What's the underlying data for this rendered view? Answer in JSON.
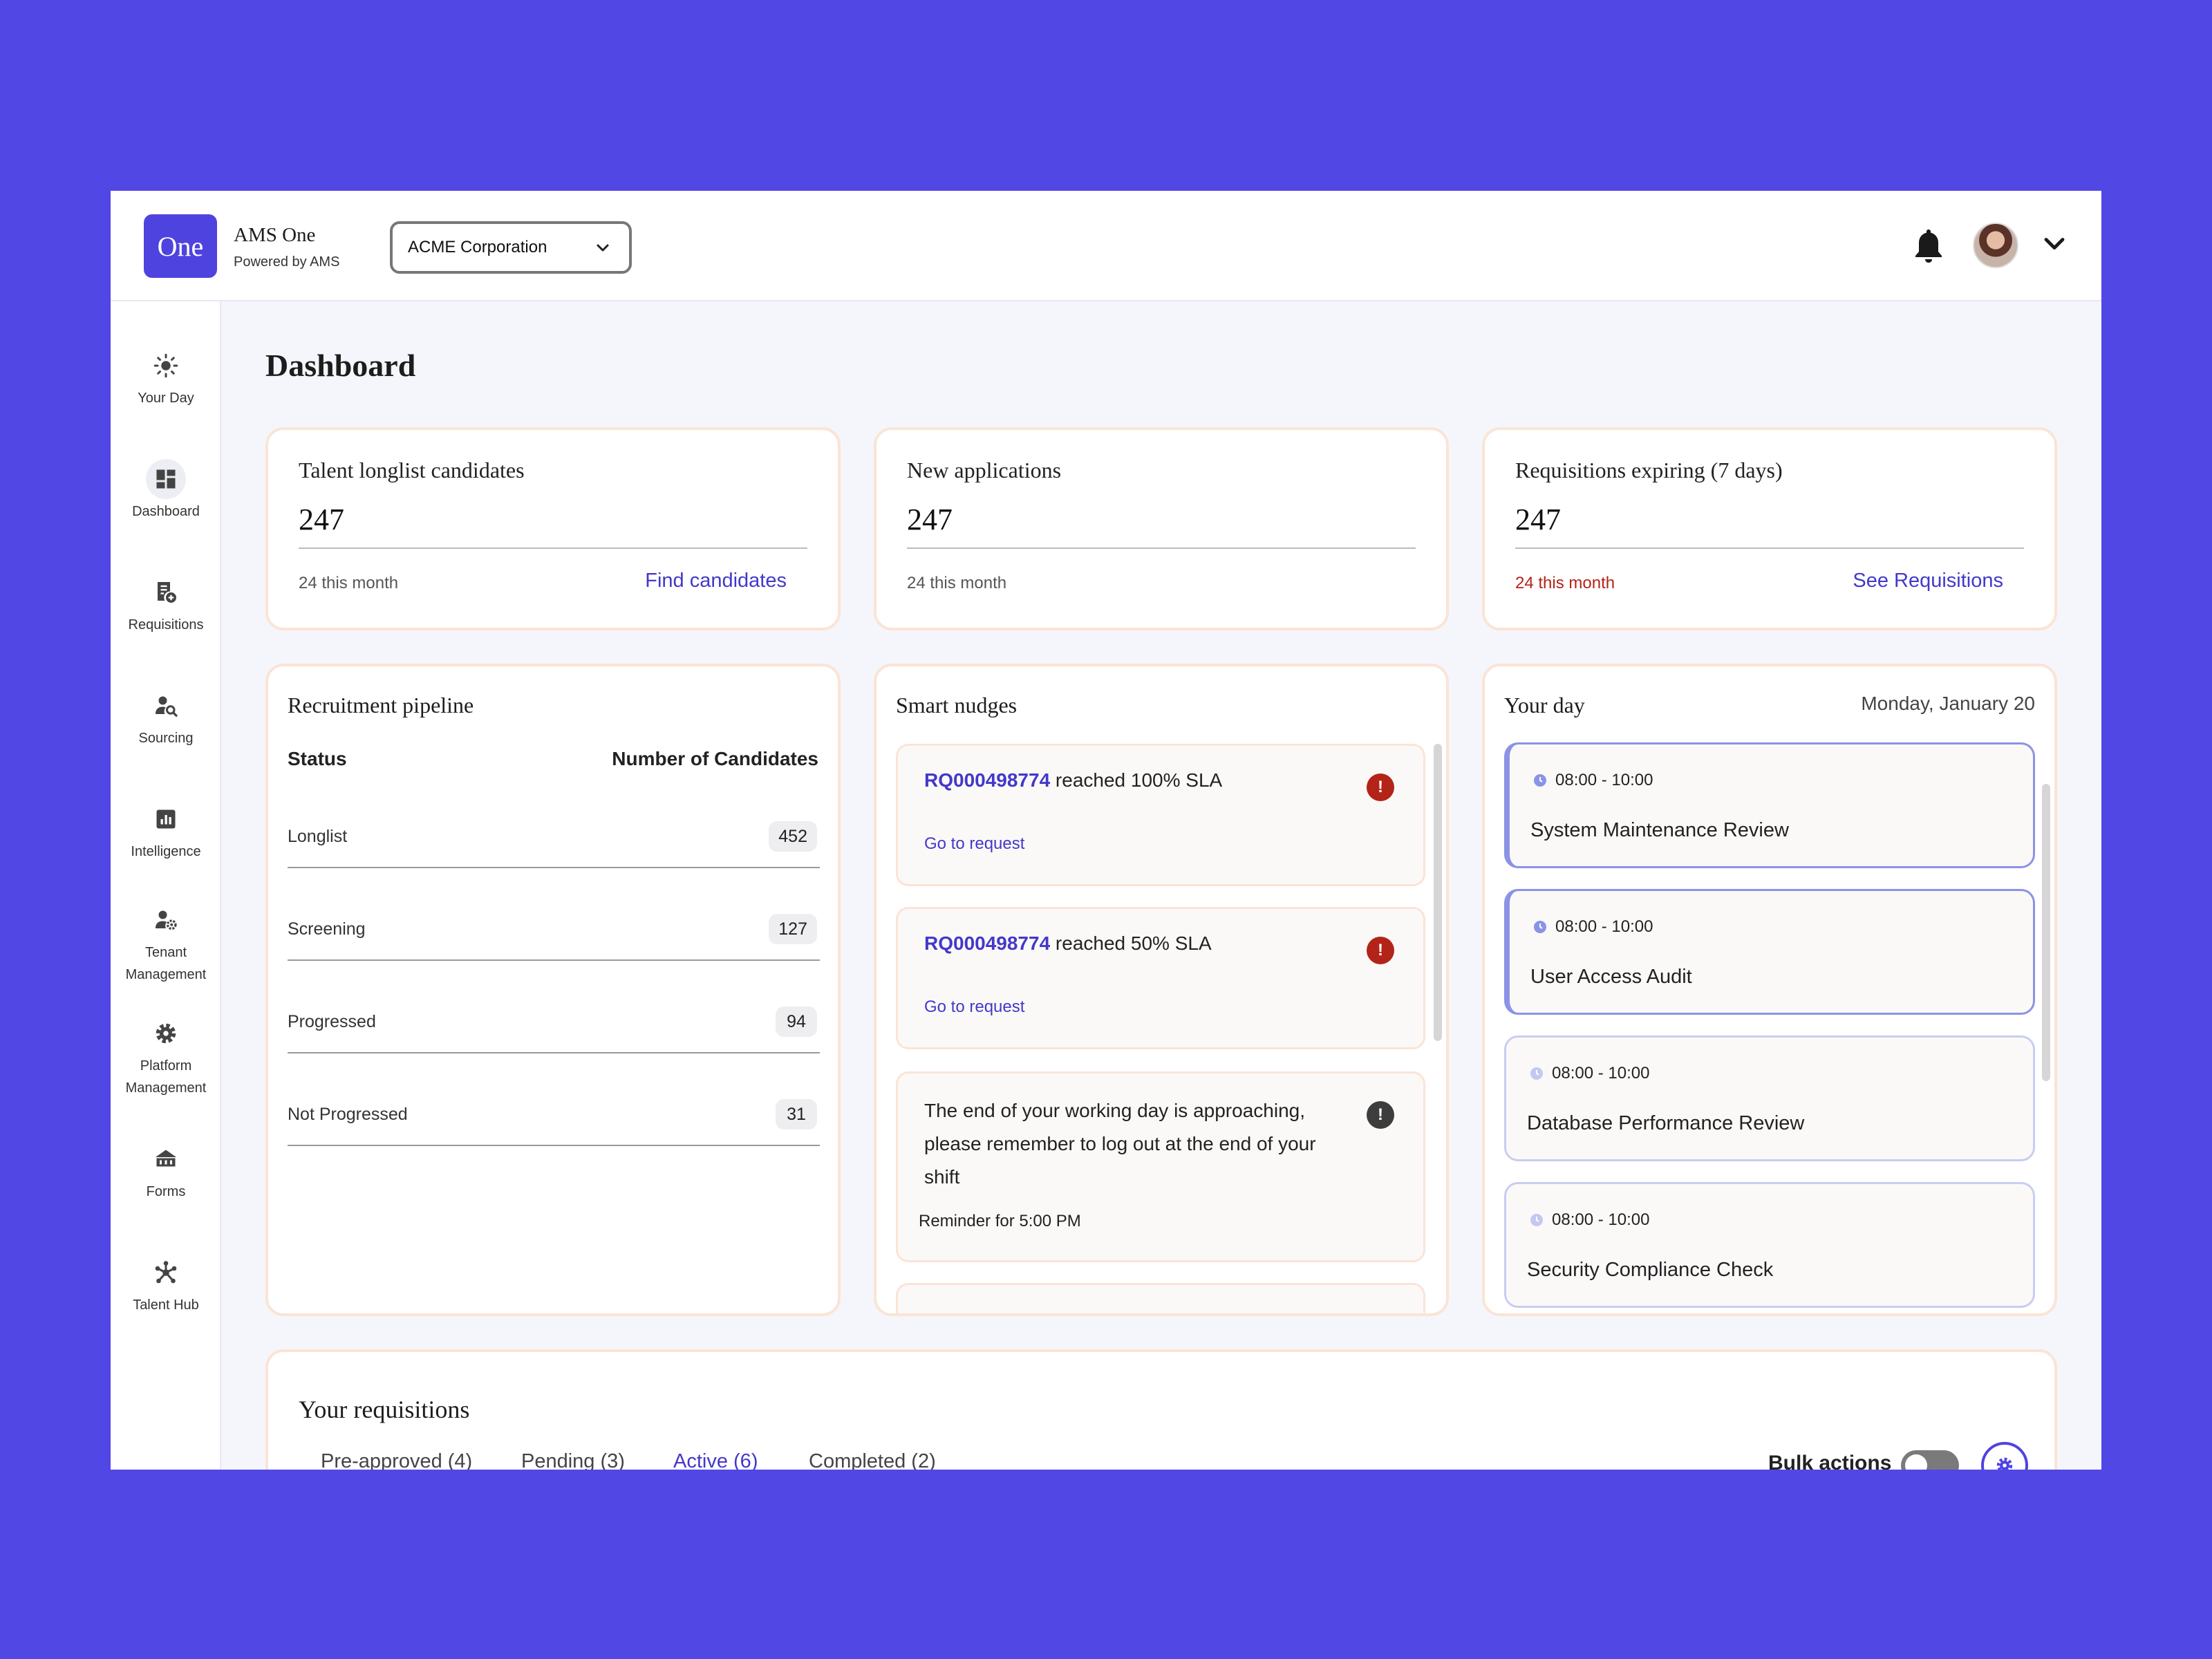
{
  "header": {
    "logo_text": "One",
    "app_name": "AMS One",
    "app_sub": "Powered by AMS",
    "org_selected": "ACME Corporation"
  },
  "sidebar": {
    "items": [
      {
        "label": "Your Day",
        "icon": "sun-icon"
      },
      {
        "label": "Dashboard",
        "icon": "dashboard-icon"
      },
      {
        "label": "Requisitions",
        "icon": "requisition-icon"
      },
      {
        "label": "Sourcing",
        "icon": "person-search-icon"
      },
      {
        "label": "Intelligence",
        "icon": "chart-icon"
      },
      {
        "label": "Tenant Management",
        "icon": "person-gear-icon"
      },
      {
        "label": "Platform Management",
        "icon": "gear-icon"
      },
      {
        "label": "Forms",
        "icon": "building-icon"
      },
      {
        "label": "Talent Hub",
        "icon": "network-icon"
      }
    ]
  },
  "page_title": "Dashboard",
  "stats": [
    {
      "title": "Talent longlist candidates",
      "value": "247",
      "sub": "24 this month",
      "link": "Find candidates"
    },
    {
      "title": "New applications",
      "value": "247",
      "sub": "24 this month",
      "link": ""
    },
    {
      "title": "Requisitions expiring (7 days)",
      "value": "247",
      "sub": "24 this month",
      "link": "See Requisitions"
    }
  ],
  "pipeline": {
    "title": "Recruitment pipeline",
    "col_status": "Status",
    "col_count": "Number of Candidates",
    "rows": [
      {
        "label": "Longlist",
        "count": "452"
      },
      {
        "label": "Screening",
        "count": "127"
      },
      {
        "label": "Progressed",
        "count": "94"
      },
      {
        "label": "Not Progressed",
        "count": "31"
      }
    ]
  },
  "nudges": {
    "title": "Smart nudges",
    "items": [
      {
        "req": "RQ000498774",
        "text": " reached 100% SLA",
        "link": "Go to request"
      },
      {
        "req": "RQ000498774",
        "text": " reached 50% SLA",
        "link": "Go to request"
      }
    ],
    "reminder": {
      "text": "The end of your working day is approaching, please remember to log out at the end of your shift",
      "sub": "Reminder for 5:00 PM"
    }
  },
  "your_day": {
    "title": "Your day",
    "date": "Monday, January 20",
    "events": [
      {
        "time": "08:00 - 10:00",
        "title": "System Maintenance Review"
      },
      {
        "time": "08:00 - 10:00",
        "title": "User Access Audit"
      },
      {
        "time": "08:00 - 10:00",
        "title": "Database Performance Review"
      },
      {
        "time": "08:00 - 10:00",
        "title": "Security Compliance Check"
      }
    ]
  },
  "requisitions": {
    "title": "Your requisitions",
    "tabs": [
      "Pre-approved (4)",
      "Pending (3)",
      "Active (6)",
      "Completed (2)"
    ],
    "active_tab": "Active (6)",
    "bulk_label": "Bulk actions"
  },
  "colors": {
    "background": "#5147e5",
    "brand": "#4f43e0",
    "link": "#4338ca",
    "alert_red": "#b42318",
    "card_border": "#fbe4d6"
  }
}
